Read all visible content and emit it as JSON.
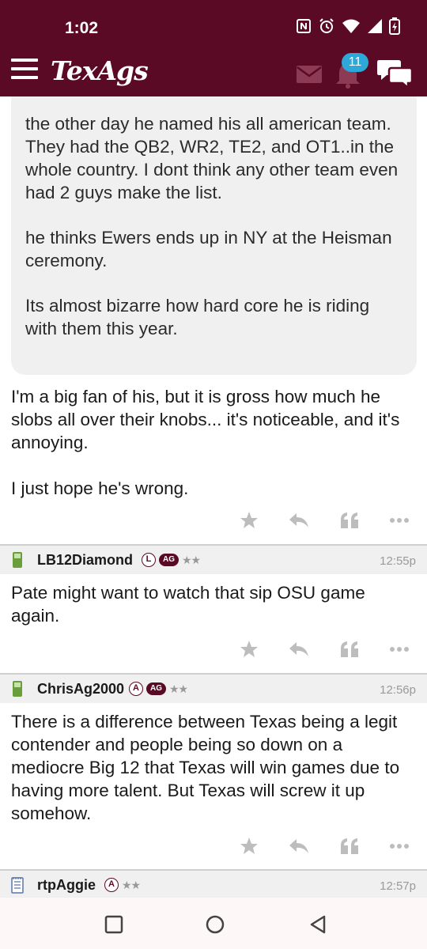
{
  "status": {
    "time": "1:02"
  },
  "app": {
    "logo": "TexAgs",
    "notification_count": "11"
  },
  "quote": {
    "paragraphs": [
      "the other day he named his all american team. They had the QB2, WR2, TE2, and OT1..in the whole country. I dont think any other team even had 2 guys make the list.",
      "he thinks Ewers ends up in NY at the Heisman ceremony.",
      "Its almost bizarre how hard core he is riding with them this year."
    ]
  },
  "reply": {
    "paragraphs": [
      "I'm a big fan of his, but it is gross how much he slobs all over their knobs... it's noticeable, and it's annoying.",
      "I just hope he's wrong."
    ]
  },
  "posts": [
    {
      "user": "LB12Diamond",
      "level": "L",
      "ag": "AG",
      "stars": "★★",
      "time": "12:55p",
      "text": "Pate might want to watch that sip OSU game again."
    },
    {
      "user": "ChrisAg2000",
      "level": "A",
      "ag": "AG",
      "stars": "★★",
      "time": "12:56p",
      "text": "There is a difference between Texas being a legit contender and people being so down on a mediocre Big 12 that Texas will win games due to having more talent. But Texas will screw it up somehow."
    },
    {
      "user": "rtpAggie",
      "level": "A",
      "stars": "★★",
      "time": "12:57p"
    }
  ],
  "icons": {
    "menu": "hamburger-icon",
    "mail": "mail-icon",
    "bell": "bell-icon",
    "chat": "chat-icon",
    "star": "star-icon",
    "reply": "reply-icon",
    "quote": "quote-icon",
    "more": "more-icon",
    "phone": "phone-icon",
    "notepad": "notepad-icon"
  },
  "colors": {
    "brand": "#5b0a26",
    "badge": "#2ea8d8"
  }
}
